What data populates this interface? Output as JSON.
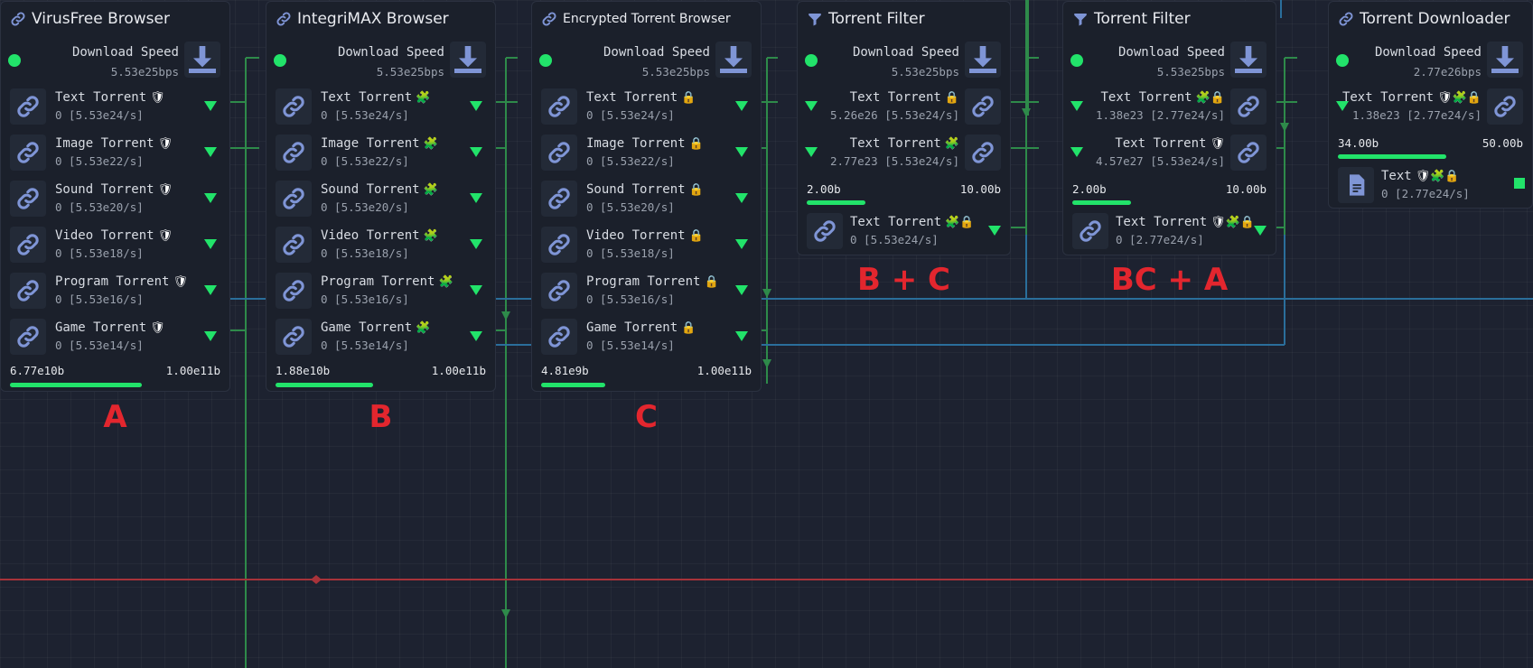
{
  "colors": {
    "accent": "#22e36a",
    "wire_green": "#2e8a4a",
    "wire_blue": "#2a6e9b",
    "wire_red": "#a8333a",
    "annotation": "#e3262e"
  },
  "nodes": [
    {
      "title": "VirusFree Browser",
      "icon": "link-icon",
      "speed_label": "Download Speed",
      "speed_value": "5.53e25bps",
      "items": [
        {
          "label": "Text Torrent",
          "badge": "🛡",
          "value": "0 [5.53e24/s]"
        },
        {
          "label": "Image Torrent",
          "badge": "🛡",
          "value": "0 [5.53e22/s]"
        },
        {
          "label": "Sound Torrent",
          "badge": "🛡",
          "value": "0 [5.53e20/s]"
        },
        {
          "label": "Video Torrent",
          "badge": "🛡",
          "value": "0 [5.53e18/s]"
        },
        {
          "label": "Program Torrent",
          "badge": "🛡",
          "value": "0 [5.53e16/s]"
        },
        {
          "label": "Game Torrent",
          "badge": "🛡",
          "value": "0 [5.53e14/s]"
        }
      ],
      "storage_current": "6.77e10b",
      "storage_max": "1.00e11b",
      "storage_fill": 0.62,
      "annotation": "A"
    },
    {
      "title": "IntegriMAX Browser",
      "icon": "link-icon",
      "speed_label": "Download Speed",
      "speed_value": "5.53e25bps",
      "items": [
        {
          "label": "Text Torrent",
          "badge": "🧩",
          "value": "0 [5.53e24/s]"
        },
        {
          "label": "Image Torrent",
          "badge": "🧩",
          "value": "0 [5.53e22/s]"
        },
        {
          "label": "Sound Torrent",
          "badge": "🧩",
          "value": "0 [5.53e20/s]"
        },
        {
          "label": "Video Torrent",
          "badge": "🧩",
          "value": "0 [5.53e18/s]"
        },
        {
          "label": "Program Torrent",
          "badge": "🧩",
          "value": "0 [5.53e16/s]"
        },
        {
          "label": "Game Torrent",
          "badge": "🧩",
          "value": "0 [5.53e14/s]"
        }
      ],
      "storage_current": "1.88e10b",
      "storage_max": "1.00e11b",
      "storage_fill": 0.46,
      "annotation": "B"
    },
    {
      "title": "Encrypted Torrent Browser",
      "icon": "link-icon",
      "speed_label": "Download Speed",
      "speed_value": "5.53e25bps",
      "items": [
        {
          "label": "Text Torrent",
          "badge": "🔒",
          "value": "0 [5.53e24/s]"
        },
        {
          "label": "Image Torrent",
          "badge": "🔒",
          "value": "0 [5.53e22/s]"
        },
        {
          "label": "Sound Torrent",
          "badge": "🔒",
          "value": "0 [5.53e20/s]"
        },
        {
          "label": "Video Torrent",
          "badge": "🔒",
          "value": "0 [5.53e18/s]"
        },
        {
          "label": "Program Torrent",
          "badge": "🔒",
          "value": "0 [5.53e16/s]"
        },
        {
          "label": "Game Torrent",
          "badge": "🔒",
          "value": "0 [5.53e14/s]"
        }
      ],
      "storage_current": "4.81e9b",
      "storage_max": "1.00e11b",
      "storage_fill": 0.3,
      "annotation": "C"
    },
    {
      "title": "Torrent Filter",
      "icon": "filter-icon",
      "speed_label": "Download Speed",
      "speed_value": "5.53e25bps",
      "inputs": [
        {
          "label": "Text Torrent",
          "badge": "🔒",
          "value": "5.26e26 [5.53e24/s]"
        },
        {
          "label": "Text Torrent",
          "badge": "🧩",
          "value": "2.77e23 [5.53e24/s]"
        }
      ],
      "storage_current": "2.00b",
      "storage_max": "10.00b",
      "storage_fill": 0.3,
      "output": {
        "label": "Text Torrent",
        "badge": "🧩🔒",
        "value": "0 [5.53e24/s]"
      },
      "annotation": "B + C"
    },
    {
      "title": "Torrent Filter",
      "icon": "filter-icon",
      "speed_label": "Download Speed",
      "speed_value": "5.53e25bps",
      "inputs": [
        {
          "label": "Text Torrent",
          "badge": "🧩🔒",
          "value": "1.38e23 [2.77e24/s]"
        },
        {
          "label": "Text Torrent",
          "badge": "🛡",
          "value": "4.57e27 [5.53e24/s]"
        }
      ],
      "storage_current": "2.00b",
      "storage_max": "10.00b",
      "storage_fill": 0.3,
      "output": {
        "label": "Text Torrent",
        "badge": "🛡🧩🔒",
        "value": "0 [2.77e24/s]"
      },
      "annotation": "BC + A"
    },
    {
      "title": "Torrent Downloader",
      "icon": "link-icon",
      "speed_label": "Download Speed",
      "speed_value": "2.77e26bps",
      "inputs": [
        {
          "label": "Text Torrent",
          "badge": "🛡🧩🔒",
          "value": "1.38e23 [2.77e24/s]"
        }
      ],
      "storage_current": "34.00b",
      "storage_max": "50.00b",
      "storage_fill": 0.58,
      "output": {
        "label": "Text",
        "badge": "🛡🧩🔒",
        "value": "0 [2.77e24/s]"
      }
    }
  ]
}
